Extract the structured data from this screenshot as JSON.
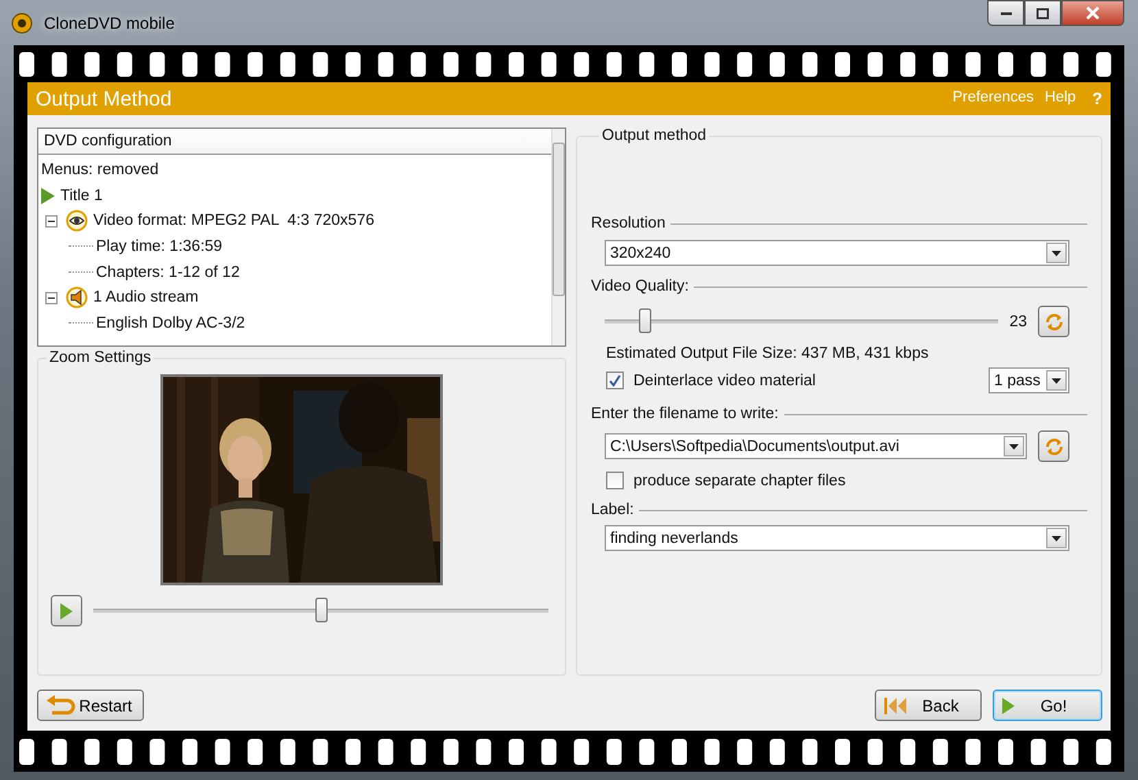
{
  "window": {
    "title": "CloneDVD mobile"
  },
  "header": {
    "title": "Output Method",
    "links": [
      "Preferences",
      "Help",
      "?"
    ]
  },
  "tree": {
    "heading": "DVD configuration",
    "items": [
      {
        "label": "Menus: removed",
        "kind": "text"
      },
      {
        "label": "Title 1",
        "kind": "title"
      },
      {
        "label": "Video format: MPEG2 PAL  4:3 720x576",
        "kind": "video",
        "expanded": true,
        "children": [
          {
            "label": "Play time: 1:36:59"
          },
          {
            "label": "Chapters: 1-12 of 12"
          }
        ]
      },
      {
        "label": "1 Audio stream",
        "kind": "audio",
        "expanded": true,
        "children": [
          {
            "label": "English Dolby AC-3/2"
          }
        ]
      }
    ]
  },
  "zoom": {
    "title": "Zoom Settings",
    "slider": {
      "level": 0.5
    }
  },
  "output": {
    "title": "Output method",
    "resolution": {
      "label": "Resolution",
      "value": "320x240"
    },
    "quality": {
      "label": "Video Quality:",
      "level": 0.1,
      "reading": "23",
      "estimate": "Estimated Output File Size: 437 MB, 431 kbps"
    },
    "deinterlace": {
      "label": "Deinterlace video material",
      "checked": true,
      "passes": "1 pass"
    },
    "filename": {
      "label": "Enter the filename to write:",
      "value": "C:\\Users\\Softpedia\\Documents\\output.avi"
    },
    "separate": {
      "label": "produce separate chapter files",
      "checked": false
    },
    "name_label": {
      "label": "Label:",
      "value": "finding neverlands"
    }
  },
  "buttons": {
    "restart": "Restart",
    "back": "Back",
    "go": "Go!"
  }
}
